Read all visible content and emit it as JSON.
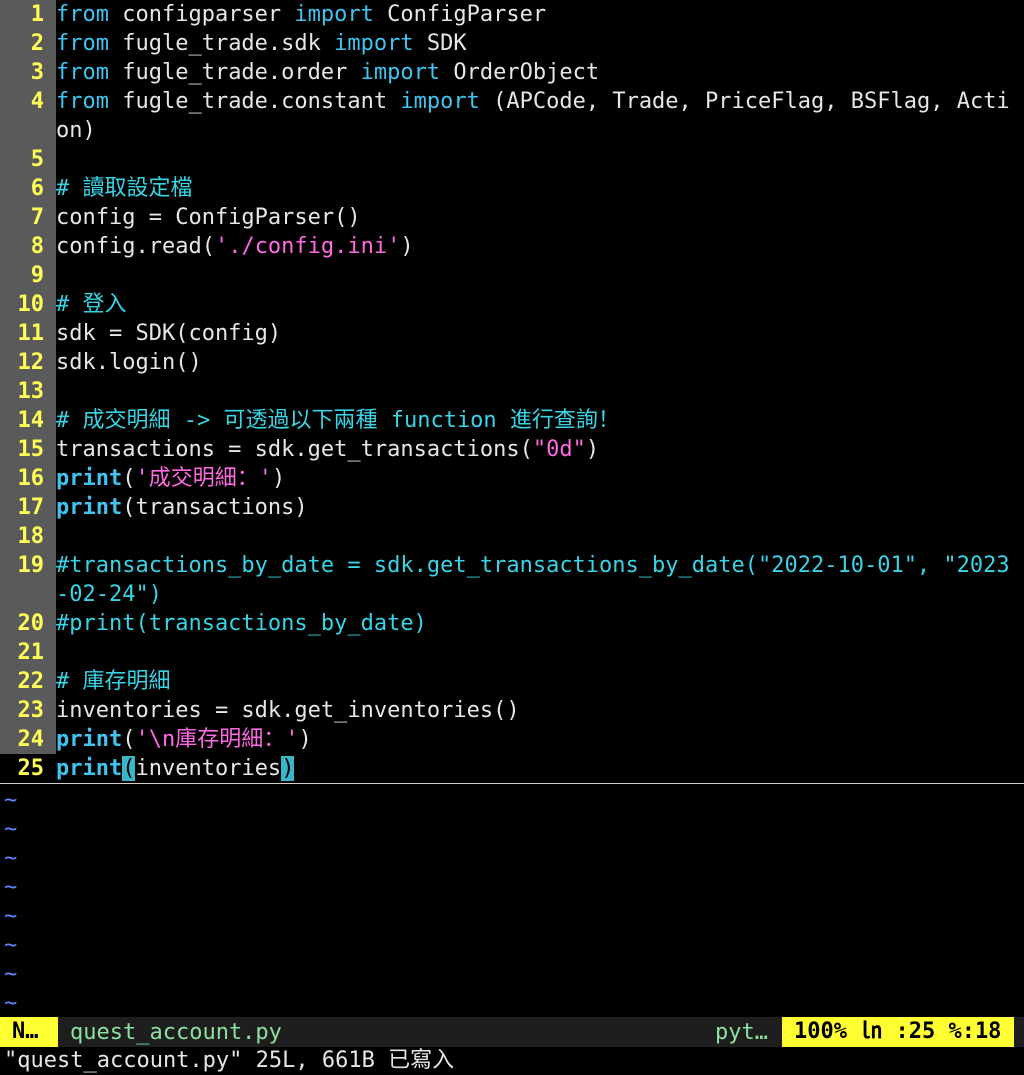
{
  "code": [
    {
      "n": "1",
      "tokens": [
        [
          "kw",
          "from"
        ],
        [
          "tx",
          " configparser "
        ],
        [
          "kw",
          "import"
        ],
        [
          "tx",
          " ConfigParser"
        ]
      ]
    },
    {
      "n": "2",
      "tokens": [
        [
          "kw",
          "from"
        ],
        [
          "tx",
          " fugle_trade.sdk "
        ],
        [
          "kw",
          "import"
        ],
        [
          "tx",
          " SDK"
        ]
      ]
    },
    {
      "n": "3",
      "tokens": [
        [
          "kw",
          "from"
        ],
        [
          "tx",
          " fugle_trade.order "
        ],
        [
          "kw",
          "import"
        ],
        [
          "tx",
          " OrderObject"
        ]
      ]
    },
    {
      "n": "4",
      "tokens": [
        [
          "kw",
          "from"
        ],
        [
          "tx",
          " fugle_trade.constant "
        ],
        [
          "kw",
          "import"
        ],
        [
          "tx",
          " (APCode, Trade, PriceFlag, BSFlag, Acti"
        ]
      ],
      "wrap": [
        [
          "tx",
          "on)"
        ]
      ]
    },
    {
      "n": "5",
      "tokens": []
    },
    {
      "n": "6",
      "tokens": [
        [
          "cm",
          "# 讀取設定檔"
        ]
      ]
    },
    {
      "n": "7",
      "tokens": [
        [
          "tx",
          "config = ConfigParser()"
        ]
      ]
    },
    {
      "n": "8",
      "tokens": [
        [
          "tx",
          "config.read("
        ],
        [
          "st",
          "'./config.ini'"
        ],
        [
          "tx",
          ")"
        ]
      ]
    },
    {
      "n": "9",
      "tokens": []
    },
    {
      "n": "10",
      "tokens": [
        [
          "cm",
          "# 登入"
        ]
      ]
    },
    {
      "n": "11",
      "tokens": [
        [
          "tx",
          "sdk = SDK(config)"
        ]
      ]
    },
    {
      "n": "12",
      "tokens": [
        [
          "tx",
          "sdk.login()"
        ]
      ]
    },
    {
      "n": "13",
      "tokens": []
    },
    {
      "n": "14",
      "tokens": [
        [
          "cm",
          "# 成交明細 -> 可透過以下兩種 function 進行查詢！"
        ]
      ]
    },
    {
      "n": "15",
      "tokens": [
        [
          "tx",
          "transactions = sdk.get_transactions("
        ],
        [
          "st",
          "\"0d\""
        ],
        [
          "tx",
          ")"
        ]
      ]
    },
    {
      "n": "16",
      "tokens": [
        [
          "pr",
          "print"
        ],
        [
          "tx",
          "("
        ],
        [
          "st",
          "'成交明細：'"
        ],
        [
          "tx",
          ")"
        ]
      ]
    },
    {
      "n": "17",
      "tokens": [
        [
          "pr",
          "print"
        ],
        [
          "tx",
          "(transactions)"
        ]
      ]
    },
    {
      "n": "18",
      "tokens": []
    },
    {
      "n": "19",
      "tokens": [
        [
          "cm",
          "#transactions_by_date = sdk.get_transactions_by_date(\"2022-10-01\", \"2023"
        ]
      ],
      "wrap": [
        [
          "cm",
          "-02-24\")"
        ]
      ]
    },
    {
      "n": "20",
      "tokens": [
        [
          "cm",
          "#print(transactions_by_date)"
        ]
      ]
    },
    {
      "n": "21",
      "tokens": []
    },
    {
      "n": "22",
      "tokens": [
        [
          "cm",
          "# 庫存明細"
        ]
      ]
    },
    {
      "n": "23",
      "tokens": [
        [
          "tx",
          "inventories = sdk.get_inventories()"
        ]
      ]
    },
    {
      "n": "24",
      "tokens": [
        [
          "pr",
          "print"
        ],
        [
          "tx",
          "("
        ],
        [
          "st",
          "'\\n庫存明細：'"
        ],
        [
          "tx",
          ")"
        ]
      ]
    },
    {
      "n": "25",
      "tokens": [
        [
          "pr",
          "print"
        ],
        [
          "hl",
          "("
        ],
        [
          "tx",
          "inventories"
        ],
        [
          "hl",
          ")"
        ]
      ],
      "current": true
    }
  ],
  "tilde_char": "~",
  "tilde_count": 8,
  "statusline": {
    "mode": "N…",
    "filename": "quest_account.py",
    "filetype": "pyt…",
    "position": "100%  ㏑ :25 %:18"
  },
  "message": "\"quest_account.py\" 25L, 661B 已寫入",
  "colors": {
    "keyword": "#3fc4f0",
    "comment": "#38d4e6",
    "string": "#ff6ae3",
    "line_number": "#ffff55",
    "gutter_bg": "#5a5a5a",
    "tilde": "#5f87ff",
    "status_accent": "#ffff33"
  }
}
